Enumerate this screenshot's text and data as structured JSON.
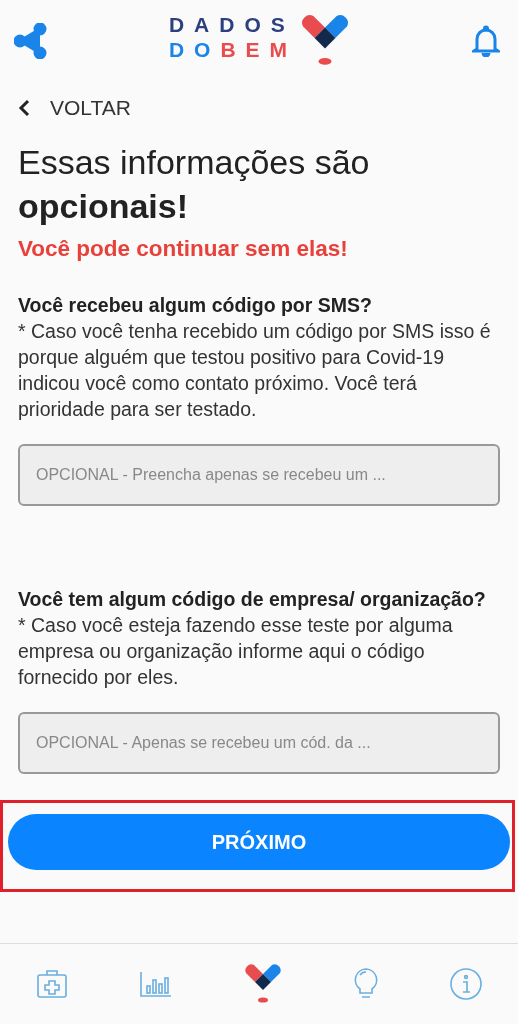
{
  "header": {
    "logo": {
      "line_1": "DADOS",
      "line_2_part_1": "DO",
      "line_2_part_2": "BEM"
    }
  },
  "back": {
    "label": "VOLTAR"
  },
  "title": {
    "line_1": "Essas informações são",
    "line_2": "opcionais!"
  },
  "subtitle": "Você pode continuar sem elas!",
  "questions": [
    {
      "label": "Você recebeu algum código por SMS?",
      "note": "* Caso você tenha recebido um código por SMS isso é porque alguém que testou positivo para Covid-19 indicou você como contato próximo. Você terá prioridade para ser testado.",
      "placeholder": "OPCIONAL - Preencha apenas se recebeu um ..."
    },
    {
      "label": "Você tem algum código de empresa/ organização?",
      "note": "* Caso você esteja fazendo esse teste por alguma empresa ou organização informe aqui o código fornecido por eles.",
      "placeholder": "OPCIONAL - Apenas se recebeu um cód. da ..."
    }
  ],
  "next_button": {
    "label": "PRÓXIMO",
    "highlighted": true
  },
  "bottom_nav": [
    {
      "kind": "kit"
    },
    {
      "kind": "chart"
    },
    {
      "kind": "heart"
    },
    {
      "kind": "bulb"
    },
    {
      "kind": "info"
    }
  ]
}
